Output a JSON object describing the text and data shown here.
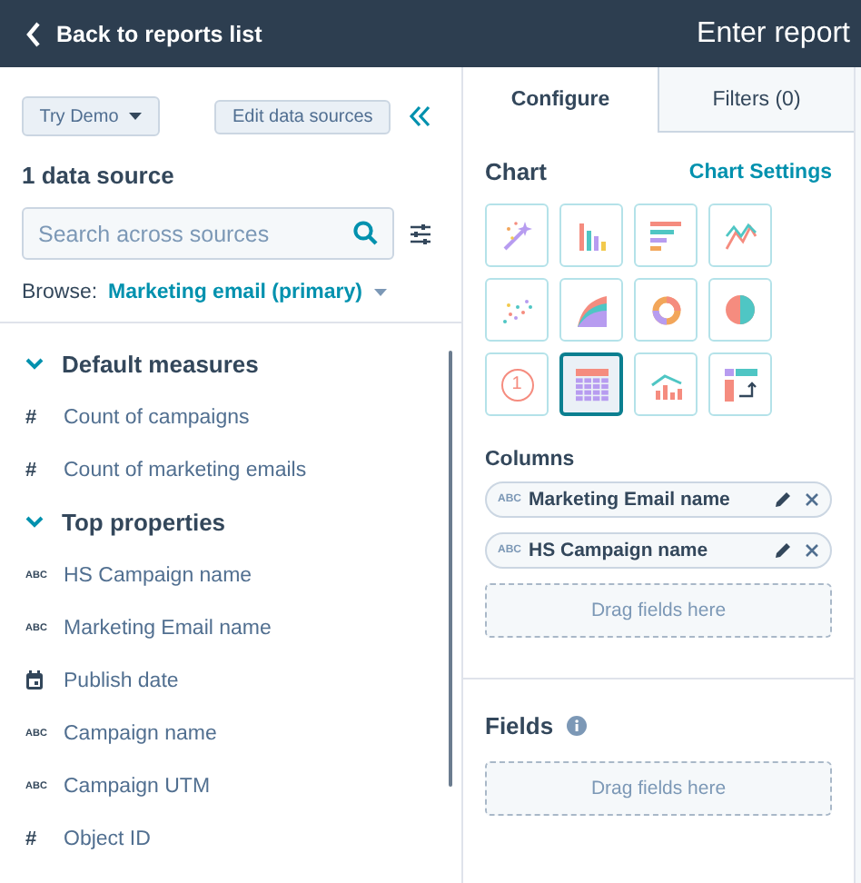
{
  "header": {
    "back_link": "Back to reports list",
    "report_title": "Enter report"
  },
  "sources_panel": {
    "try_demo_button": "Try Demo",
    "edit_sources_button": "Edit data sources",
    "heading": "1 data source",
    "search": {
      "placeholder": "Search across sources"
    },
    "browse_label": "Browse:",
    "browse_value": "Marketing email (primary)"
  },
  "field_groups": [
    {
      "title": "Default measures",
      "expanded": true,
      "items": [
        {
          "kind": "number",
          "glyph": "#",
          "label": "Count of campaigns"
        },
        {
          "kind": "number",
          "glyph": "#",
          "label": "Count of marketing emails"
        }
      ]
    },
    {
      "title": "Top properties",
      "expanded": true,
      "items": [
        {
          "kind": "text",
          "glyph": "ABC",
          "label": "HS Campaign name"
        },
        {
          "kind": "text",
          "glyph": "ABC",
          "label": "Marketing Email name"
        },
        {
          "kind": "date",
          "label": "Publish date"
        },
        {
          "kind": "text",
          "glyph": "ABC",
          "label": "Campaign name"
        },
        {
          "kind": "text",
          "glyph": "ABC",
          "label": "Campaign UTM"
        },
        {
          "kind": "number",
          "glyph": "#",
          "label": "Object ID"
        }
      ]
    }
  ],
  "tabs": [
    {
      "label": "Configure",
      "selected": true
    },
    {
      "label": "Filters (0)",
      "selected": false
    }
  ],
  "chart": {
    "title": "Chart",
    "settings_link": "Chart Settings",
    "types": [
      {
        "kind": "auto",
        "selected": false
      },
      {
        "kind": "column",
        "selected": false
      },
      {
        "kind": "bar",
        "selected": false
      },
      {
        "kind": "line",
        "selected": false
      },
      {
        "kind": "scatter",
        "selected": false
      },
      {
        "kind": "area",
        "selected": false
      },
      {
        "kind": "donut",
        "selected": false
      },
      {
        "kind": "pie",
        "selected": false
      },
      {
        "kind": "kpi",
        "label": "1",
        "selected": false
      },
      {
        "kind": "table",
        "selected": true
      },
      {
        "kind": "combo",
        "selected": false
      },
      {
        "kind": "pivot",
        "selected": false
      }
    ]
  },
  "columns": {
    "title": "Columns",
    "items": [
      {
        "glyph": "ABC",
        "label": "Marketing Email name"
      },
      {
        "glyph": "ABC",
        "label": "HS Campaign name"
      }
    ],
    "dropzone": "Drag fields here"
  },
  "fields": {
    "title": "Fields",
    "dropzone": "Drag fields here"
  }
}
